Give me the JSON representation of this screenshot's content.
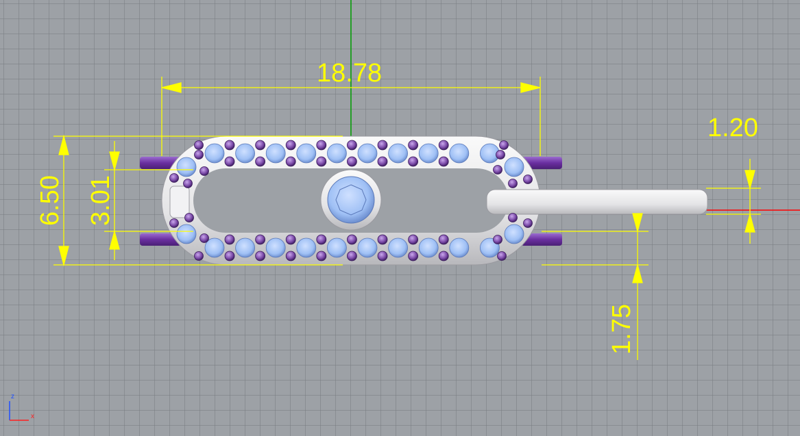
{
  "viewport": {
    "background_color": "#9da1a6",
    "grid_color": "#7f8388",
    "dimension_color": "#ffff00",
    "x_axis_color": "#ff0000",
    "y_axis_color": "#00a000",
    "metal_color": "#e8e8ea",
    "gem_color": "#9fc0f5",
    "accent_gem_color": "#7b4aa8",
    "bar_color": "#6a2fa0"
  },
  "dimensions": {
    "length": "18.78",
    "height": "6.50",
    "inner_height": "3.01",
    "tab_thickness": "1.20",
    "offset": "1.75"
  },
  "axis_widget": {
    "z_label": "z",
    "x_label": "x"
  }
}
